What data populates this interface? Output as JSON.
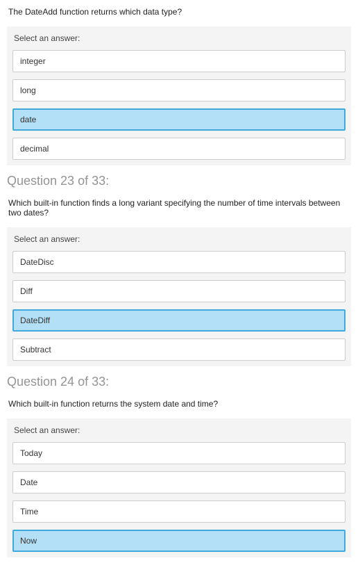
{
  "q22": {
    "text": "The DateAdd function returns which data type?",
    "select_label": "Select an answer:",
    "options": [
      {
        "label": "integer",
        "selected": false
      },
      {
        "label": "long",
        "selected": false
      },
      {
        "label": "date",
        "selected": true
      },
      {
        "label": "decimal",
        "selected": false
      }
    ]
  },
  "q23": {
    "header": "Question 23 of 33:",
    "text": "Which built-in function finds a long variant specifying the number of time intervals between two dates?",
    "select_label": "Select an answer:",
    "options": [
      {
        "label": "DateDisc",
        "selected": false
      },
      {
        "label": "Diff",
        "selected": false
      },
      {
        "label": "DateDiff",
        "selected": true
      },
      {
        "label": "Subtract",
        "selected": false
      }
    ]
  },
  "q24": {
    "header": "Question 24 of 33:",
    "text": "Which built-in function returns the system date and time?",
    "select_label": "Select an answer:",
    "options": [
      {
        "label": "Today",
        "selected": false
      },
      {
        "label": "Date",
        "selected": false
      },
      {
        "label": "Time",
        "selected": false
      },
      {
        "label": "Now",
        "selected": true
      }
    ]
  }
}
